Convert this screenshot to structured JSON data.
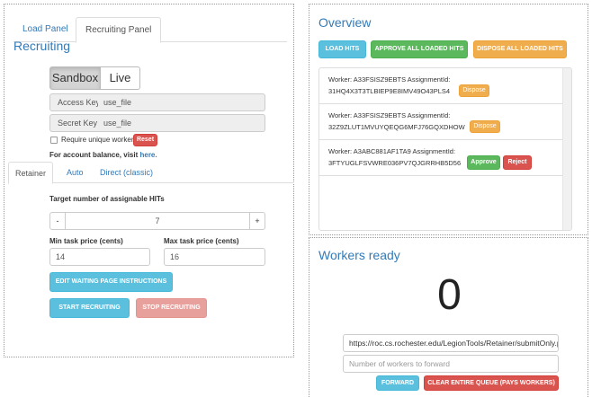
{
  "left": {
    "tabs": [
      "Load Panel",
      "Recruiting Panel"
    ],
    "title": "Recruiting",
    "mode": {
      "sandbox": "Sandbox",
      "live": "Live"
    },
    "access_key": {
      "label": "Access Key",
      "value": "use_file"
    },
    "secret_key": {
      "label": "Secret Key",
      "value": "use_file"
    },
    "unique_workers_label": "Require unique workers",
    "reset_label": "Reset",
    "account_balance_text": "For account balance, visit",
    "account_balance_link": "here.",
    "subtabs": [
      "Retainer",
      "Auto",
      "Direct (classic)"
    ],
    "target_label": "Target number of assignable HITs",
    "target_minus": "-",
    "target_value": "7",
    "target_plus": "+",
    "min_price_label": "Min task price (cents)",
    "min_price_value": "14",
    "max_price_label": "Max task price (cents)",
    "max_price_value": "16",
    "edit_waiting_label": "EDIT WAITING PAGE INSTRUCTIONS",
    "start_label": "START RECRUITING",
    "stop_label": "STOP RECRUITING"
  },
  "overview": {
    "title": "Overview",
    "load_hits": "LOAD HITS",
    "approve_all": "APPROVE ALL LOADED HITS",
    "dispose_all": "DISPOSE ALL LOADED HITS",
    "hits": [
      {
        "worker_line": "Worker: A33FSISZ9EBTS AssignmentId:",
        "assignment": "31HQ4X3T3TLBIEP9E8IMV49O43PLS4",
        "actions": [
          "Dispose"
        ]
      },
      {
        "worker_line": "Worker: A33FSISZ9EBTS AssignmentId:",
        "assignment": "32Z9ZLUT1MVUYQEQG6MFJ76GQXDHOW",
        "actions": [
          "Dispose"
        ]
      },
      {
        "worker_line": "Worker: A3ABC881AF1TA9 AssignmentId:",
        "assignment": "3FTYUGLFSVWRE036PV7QJGRRHB5D56",
        "actions": [
          "Approve",
          "Reject"
        ]
      }
    ]
  },
  "workers": {
    "title": "Workers ready",
    "count": "0",
    "url_value": "https://roc.cs.rochester.edu/LegionTools/Retainer/submitOnly.p",
    "forward_placeholder": "Number of workers to forward",
    "forward_label": "FORWARD",
    "clear_label": "CLEAR ENTIRE QUEUE (PAYS WORKERS)"
  }
}
